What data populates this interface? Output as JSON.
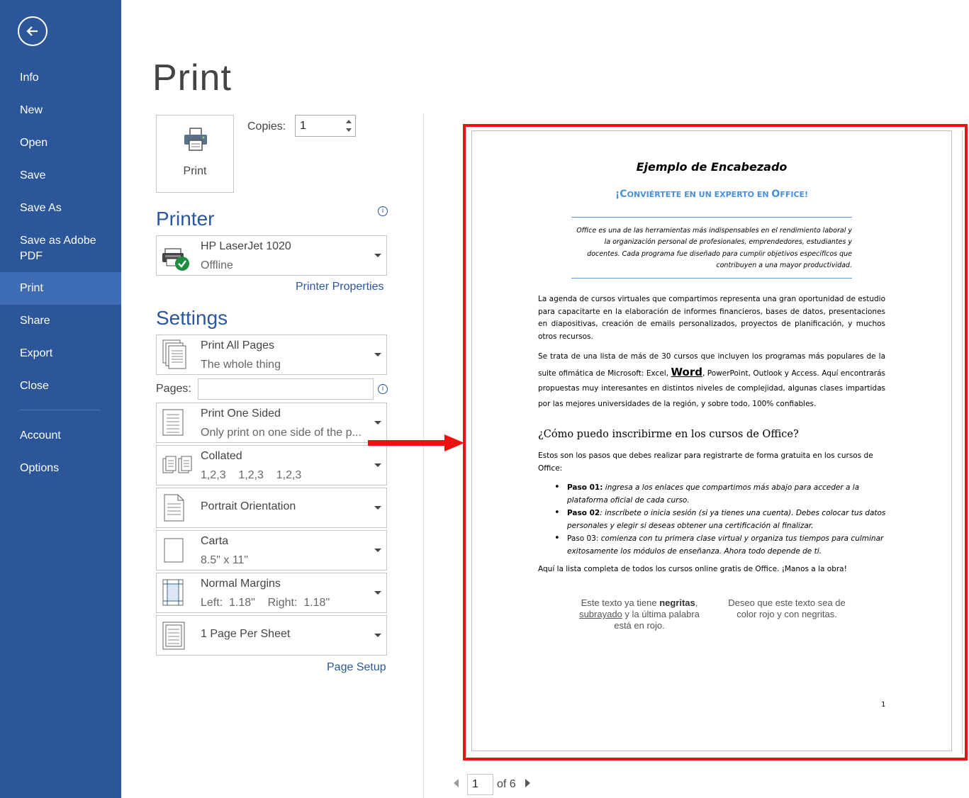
{
  "sidebar": {
    "items": [
      {
        "label": "Info"
      },
      {
        "label": "New"
      },
      {
        "label": "Open"
      },
      {
        "label": "Save"
      },
      {
        "label": "Save As"
      },
      {
        "label": "Save as Adobe\nPDF"
      },
      {
        "label": "Print"
      },
      {
        "label": "Share"
      },
      {
        "label": "Export"
      },
      {
        "label": "Close"
      },
      {
        "label": "Account"
      },
      {
        "label": "Options"
      }
    ],
    "selected": "Print"
  },
  "page_title": "Print",
  "print_button": {
    "label": "Print"
  },
  "copies": {
    "label": "Copies:",
    "value": "1"
  },
  "printer": {
    "section_title": "Printer",
    "name": "HP LaserJet 1020",
    "status": "Offline",
    "properties_link": "Printer Properties"
  },
  "settings": {
    "section_title": "Settings",
    "print_range": {
      "title": "Print All Pages",
      "subtitle": "The whole thing"
    },
    "pages_label": "Pages:",
    "pages_value": "",
    "sides": {
      "title": "Print One Sided",
      "subtitle": "Only print on one side of the p..."
    },
    "collation": {
      "title": "Collated",
      "subtitle": "1,2,3    1,2,3    1,2,3"
    },
    "orientation": {
      "title": "Portrait Orientation"
    },
    "paper": {
      "title": "Carta",
      "subtitle": "8.5\" x 11\""
    },
    "margins": {
      "title": "Normal Margins",
      "subtitle": "Left:  1.18\"    Right:  1.18\""
    },
    "per_sheet": {
      "title": "1 Page Per Sheet"
    },
    "page_setup_link": "Page Setup"
  },
  "preview": {
    "heading": "Ejemplo de Encabezado",
    "subheading_parts": [
      "¡C",
      "ONVIÉRTETE EN UN EXPERTO EN ",
      "O",
      "FFICE!"
    ],
    "quote": "Office es una de las herramientas más indispensables en el rendimiento laboral y la organización personal de profesionales, emprendedores, estudiantes y docentes. Cada programa fue diseñado para cumplir objetivos específicos que contribuyen a una mayor productividad.",
    "paragraph1": "La agenda de cursos virtuales que compartimos representa una gran oportunidad de estudio para capacitarte en la elaboración de informes financieros, bases de datos, presentaciones en diapositivas, creación de emails personalizados, proyectos de planificación, y muchos otros recursos.",
    "paragraph2_before": "Se trata de una lista de más de 30 cursos que incluyen los programas más populares de la suite ofimática de Microsoft: Excel, ",
    "paragraph2_word": "Word",
    "paragraph2_after": ", PowerPoint, Outlook y Access. Aquí encontrarás propuestas muy interesantes en distintos niveles de complejidad, algunas clases impartidas por las mejores universidades de la región, y sobre todo, 100% confiables.",
    "question_heading": "¿Cómo puedo inscribirme en los cursos de Office?",
    "steps_intro": "Estos son los pasos que debes realizar para registrarte de forma gratuita en los cursos de Office:",
    "steps": [
      {
        "label": "Paso 01:",
        "text": " ingresa a los enlaces que compartimos más abajo para acceder a la plataforma oficial de cada curso."
      },
      {
        "label": "Paso 02",
        "text": ": inscríbete o inicia sesión (si ya tienes una cuenta). Debes colocar tus datos personales y elegir si deseas obtener una certificación al finalizar."
      },
      {
        "label": "Paso 03:",
        "text": " comienza con tu primera clase virtual y organiza tus tiempos para culminar exitosamente los módulos de enseñanza. Ahora todo depende de ti."
      }
    ],
    "closing": "Aquí la lista completa de todos los cursos online gratis de Office. ¡Manos a la obra!",
    "textbox1": {
      "pre": "Este texto ya tiene ",
      "bold": "negritas",
      "comma": ",",
      "underline": "subrayado",
      "post": " y la última palabra está en rojo."
    },
    "textbox2": "Deseo que este texto sea de color rojo y con negritas.",
    "page_number": "1"
  },
  "pagination": {
    "current": "1",
    "of_label": "of 6"
  },
  "colors": {
    "accent": "#2b579a",
    "highlight_border": "#ee1111",
    "arrow": "#ee1111"
  }
}
